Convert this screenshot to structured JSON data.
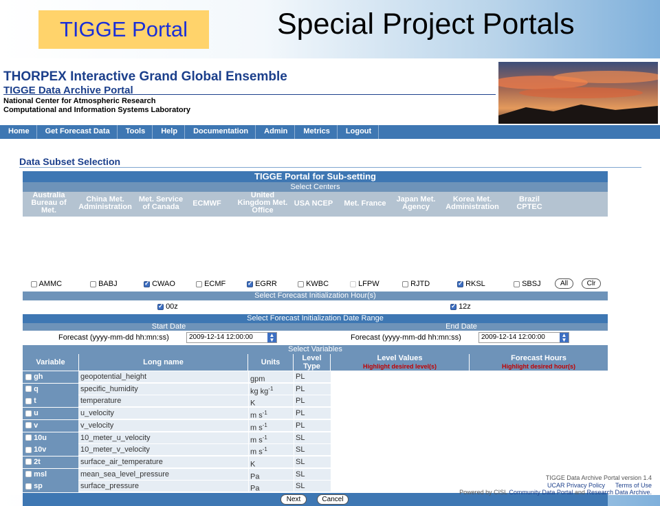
{
  "slide": {
    "tag": "TIGGE Portal",
    "title": "Special Project Portals"
  },
  "header": {
    "title": "THORPEX Interactive Grand Global Ensemble",
    "subtitle": "TIGGE Data Archive Portal",
    "org1": "National Center for Atmospheric Research",
    "org2": "Computational and Information Systems Laboratory"
  },
  "nav": [
    "Home",
    "Get Forecast Data",
    "Tools",
    "Help",
    "Documentation",
    "Admin",
    "Metrics",
    "Logout"
  ],
  "section_title": "Data Subset Selection",
  "portal": {
    "title": "TIGGE Portal for Sub-setting",
    "select_centers": "Select Centers",
    "centers": [
      {
        "name": "Australia Bureau of Met.",
        "code": "AMMC",
        "checked": false
      },
      {
        "name": "China Met. Administration",
        "code": "BABJ",
        "checked": false
      },
      {
        "name": "Met. Service of Canada",
        "code": "CWAO",
        "checked": true
      },
      {
        "name": "ECMWF",
        "code": "ECMF",
        "checked": false
      },
      {
        "name": "United Kingdom Met. Office",
        "code": "EGRR",
        "checked": true
      },
      {
        "name": "USA NCEP",
        "code": "KWBC",
        "checked": false
      },
      {
        "name": "Met. France",
        "code": "LFPW",
        "checked": false
      },
      {
        "name": "Japan Met. Agency",
        "code": "RJTD",
        "checked": false
      },
      {
        "name": "Korea Met. Administration",
        "code": "RKSL",
        "checked": true
      },
      {
        "name": "Brazil CPTEC",
        "code": "SBSJ",
        "checked": false
      }
    ],
    "all_button": "All",
    "clr_button": "Clr",
    "select_hours": "Select Forecast Initialization Hour(s)",
    "hours": [
      {
        "label": "00z",
        "checked": true
      },
      {
        "label": "12z",
        "checked": true
      }
    ],
    "select_dates": "Select Forecast Initialization Date Range",
    "start_date_label": "Start Date",
    "end_date_label": "End Date",
    "forecast_label": "Forecast (yyyy-mm-dd hh:mn:ss)",
    "start_value": "2009-12-14 12:00:00",
    "end_value": "2009-12-14 12:00:00",
    "select_variables": "Select Variables",
    "var_headers": {
      "variable": "Variable",
      "long_name": "Long name",
      "units": "Units",
      "level_type": "Level Type",
      "level_values": "Level Values",
      "level_values_hint": "Highlight desired level(s)",
      "forecast_hours": "Forecast Hours",
      "forecast_hours_hint": "Highlight desired hour(s)"
    },
    "variables": [
      {
        "var": "gh",
        "long": "geopotential_height",
        "units": "gpm",
        "level": "PL"
      },
      {
        "var": "q",
        "long": "specific_humidity",
        "units": "kg kg",
        "units_sup": "-1",
        "level": "PL"
      },
      {
        "var": "t",
        "long": "temperature",
        "units": "K",
        "level": "PL"
      },
      {
        "var": "u",
        "long": "u_velocity",
        "units": "m s",
        "units_sup": "-1",
        "level": "PL"
      },
      {
        "var": "v",
        "long": "v_velocity",
        "units": "m s",
        "units_sup": "-1",
        "level": "PL"
      },
      {
        "var": "10u",
        "long": "10_meter_u_velocity",
        "units": "m s",
        "units_sup": "-1",
        "level": "SL"
      },
      {
        "var": "10v",
        "long": "10_meter_v_velocity",
        "units": "m s",
        "units_sup": "-1",
        "level": "SL"
      },
      {
        "var": "2t",
        "long": "surface_air_temperature",
        "units": "K",
        "level": "SL"
      },
      {
        "var": "msl",
        "long": "mean_sea_level_pressure",
        "units": "Pa",
        "level": "SL"
      },
      {
        "var": "sp",
        "long": "surface_pressure",
        "units": "Pa",
        "level": "SL"
      }
    ],
    "next_button": "Next",
    "cancel_button": "Cancel"
  },
  "footer": {
    "version": "TIGGE Data Archive Portal version 1.4",
    "privacy": "UCAR Privacy Policy",
    "terms": "Terms of Use",
    "powered_prefix": "Powered by CISL",
    "community": "Community Data Portal",
    "and": "and",
    "research": "Research Data Archive."
  }
}
